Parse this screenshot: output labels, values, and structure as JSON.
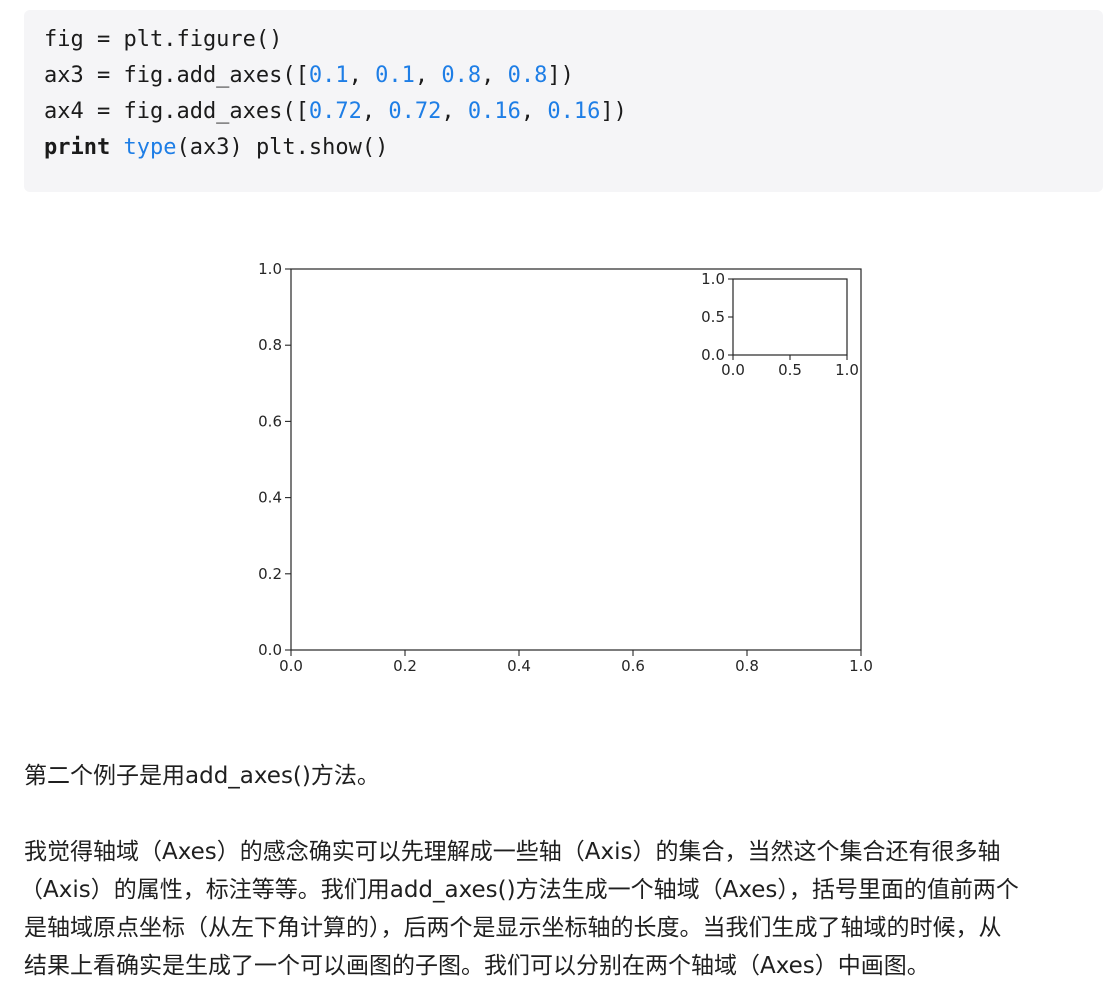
{
  "code": {
    "lines": [
      {
        "segments": [
          {
            "t": "fig = plt.figure()",
            "c": ""
          }
        ]
      },
      {
        "segments": [
          {
            "t": "ax3 = fig.add_axes([",
            "c": ""
          },
          {
            "t": "0.1",
            "c": "num"
          },
          {
            "t": ", ",
            "c": ""
          },
          {
            "t": "0.1",
            "c": "num"
          },
          {
            "t": ", ",
            "c": ""
          },
          {
            "t": "0.8",
            "c": "num"
          },
          {
            "t": ", ",
            "c": ""
          },
          {
            "t": "0.8",
            "c": "num"
          },
          {
            "t": "])",
            "c": ""
          }
        ]
      },
      {
        "segments": [
          {
            "t": "ax4 = fig.add_axes([",
            "c": ""
          },
          {
            "t": "0.72",
            "c": "num"
          },
          {
            "t": ", ",
            "c": ""
          },
          {
            "t": "0.72",
            "c": "num"
          },
          {
            "t": ", ",
            "c": ""
          },
          {
            "t": "0.16",
            "c": "num"
          },
          {
            "t": ", ",
            "c": ""
          },
          {
            "t": "0.16",
            "c": "num"
          },
          {
            "t": "])",
            "c": ""
          }
        ]
      },
      {
        "segments": [
          {
            "t": "print",
            "c": "kw"
          },
          {
            "t": " ",
            "c": ""
          },
          {
            "t": "type",
            "c": "bi"
          },
          {
            "t": "(ax3) plt.show()",
            "c": ""
          }
        ]
      }
    ]
  },
  "chart_data": [
    {
      "type": "line",
      "series": [],
      "xlim": [
        0.0,
        1.0
      ],
      "ylim": [
        0.0,
        1.0
      ],
      "xticks": [
        "0.0",
        "0.2",
        "0.4",
        "0.6",
        "0.8",
        "1.0"
      ],
      "yticks": [
        "0.0",
        "0.2",
        "0.4",
        "0.6",
        "0.8",
        "1.0"
      ],
      "grid": false
    },
    {
      "type": "line",
      "series": [],
      "xlim": [
        0.0,
        1.0
      ],
      "ylim": [
        0.0,
        1.0
      ],
      "xticks": [
        "0.0",
        "0.5",
        "1.0"
      ],
      "yticks": [
        "0.0",
        "0.5",
        "1.0"
      ],
      "grid": false
    }
  ],
  "text": {
    "para1": "第二个例子是用add_axes()方法。",
    "para2": [
      "我觉得轴域（Axes）的感念确实可以先理解成一些轴（Axis）的集合，当然这个集合还有很多轴",
      "（Axis）的属性，标注等等。我们用add_axes()方法生成一个轴域（Axes），括号里面的值前两个",
      "是轴域原点坐标（从左下角计算的），后两个是显示坐标轴的长度。当我们生成了轴域的时候，从",
      "结果上看确实是生成了一个可以画图的子图。我们可以分别在两个轴域（Axes）中画图。"
    ]
  }
}
